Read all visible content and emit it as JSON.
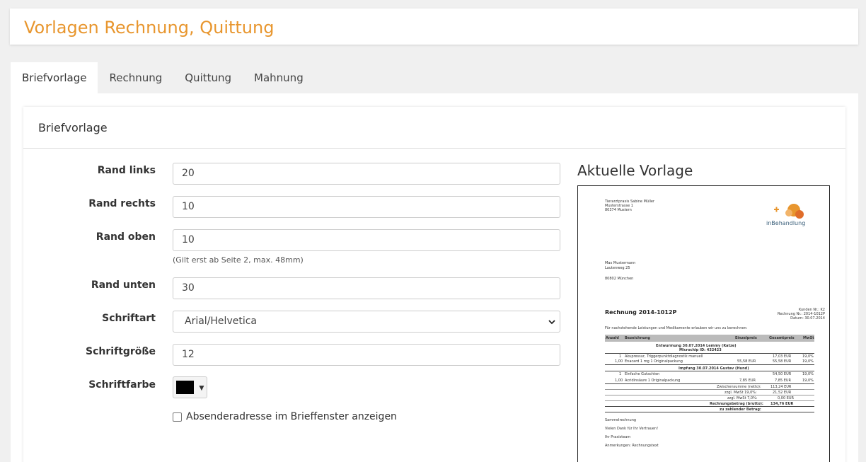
{
  "page": {
    "title": "Vorlagen Rechnung, Quittung"
  },
  "tabs": [
    {
      "label": "Briefvorlage",
      "active": true
    },
    {
      "label": "Rechnung",
      "active": false
    },
    {
      "label": "Quittung",
      "active": false
    },
    {
      "label": "Mahnung",
      "active": false
    }
  ],
  "card": {
    "title": "Briefvorlage"
  },
  "form": {
    "rand_links": {
      "label": "Rand links",
      "value": "20"
    },
    "rand_rechts": {
      "label": "Rand rechts",
      "value": "10"
    },
    "rand_oben": {
      "label": "Rand oben",
      "value": "10",
      "hint": "(Gilt erst ab Seite 2, max. 48mm)"
    },
    "rand_unten": {
      "label": "Rand unten",
      "value": "30"
    },
    "schriftart": {
      "label": "Schriftart",
      "value": "Arial/Helvetica"
    },
    "schriftgroesse": {
      "label": "Schriftgröße",
      "value": "12"
    },
    "schriftfarbe": {
      "label": "Schriftfarbe",
      "color": "#000000"
    },
    "absender": {
      "label": "Absenderadresse im Brieffenster anzeigen",
      "checked": false
    }
  },
  "preview": {
    "title": "Aktuelle Vorlage",
    "sender_lines": [
      "Tierarztpraxis Sabine Müller",
      "Musterstrasse 1",
      "80374 Mustern"
    ],
    "logo_text": "inBehandlung",
    "recipient_lines": [
      "Max Mustermann",
      "Lautenweg 25",
      "",
      "80802 München"
    ],
    "invoice_title": "Rechnung 2014-1012P",
    "meta_lines": [
      "Kunden Nr.: K2",
      "Rechnung Nr.: 2014-1012P",
      "Datum: 30.07.2014"
    ],
    "intro": "Für nachstehende Leistungen und Medikamente erlauben wir uns zu berechnen:",
    "table_headers": [
      "Anzahl",
      "Bezeichnung",
      "Einzelpreis",
      "Gesamtpreis",
      "MwSt"
    ],
    "group1": [
      "Entwurmung 30.07.2014 Lemmy (Katze)",
      "Microchip ID: 432423"
    ],
    "rows1": [
      [
        "1",
        "Akupressur, Triggerpunktdiagnostik manuell",
        "",
        "17,03 EUR",
        "19,0%"
      ],
      [
        "1,00",
        "Enacard 1 mg 1 Originalpackung",
        "55,58 EUR",
        "55,58 EUR",
        "19,0%"
      ]
    ],
    "group2": "Impfung 30.07.2014 Gustav (Hund)",
    "rows2": [
      [
        "1",
        "Einfache Gutachten",
        "",
        "54,50 EUR",
        "19,0%"
      ],
      [
        "1,00",
        "Acridinsäure 1 Originalpackung",
        "7,85 EUR",
        "7,85 EUR",
        "19,0%"
      ]
    ],
    "totals": [
      [
        "Zwischensumme (netto):",
        "113,24 EUR"
      ],
      [
        "zzgl. MwSt 19,0%:",
        "21,52 EUR"
      ],
      [
        "zzgl. MwSt 7,0%:",
        "0,00 EUR"
      ],
      [
        "Rechnungsbetrag (brutto):",
        "134,76 EUR"
      ],
      [
        "zu zahlender Betrag:",
        ""
      ]
    ],
    "footer_lines": [
      "Sammelrechnung",
      "Vielen Dank für Ihr Vertrauen!",
      "Ihr Praxisteam",
      "Anmerkungen: Rechnungstext"
    ]
  }
}
